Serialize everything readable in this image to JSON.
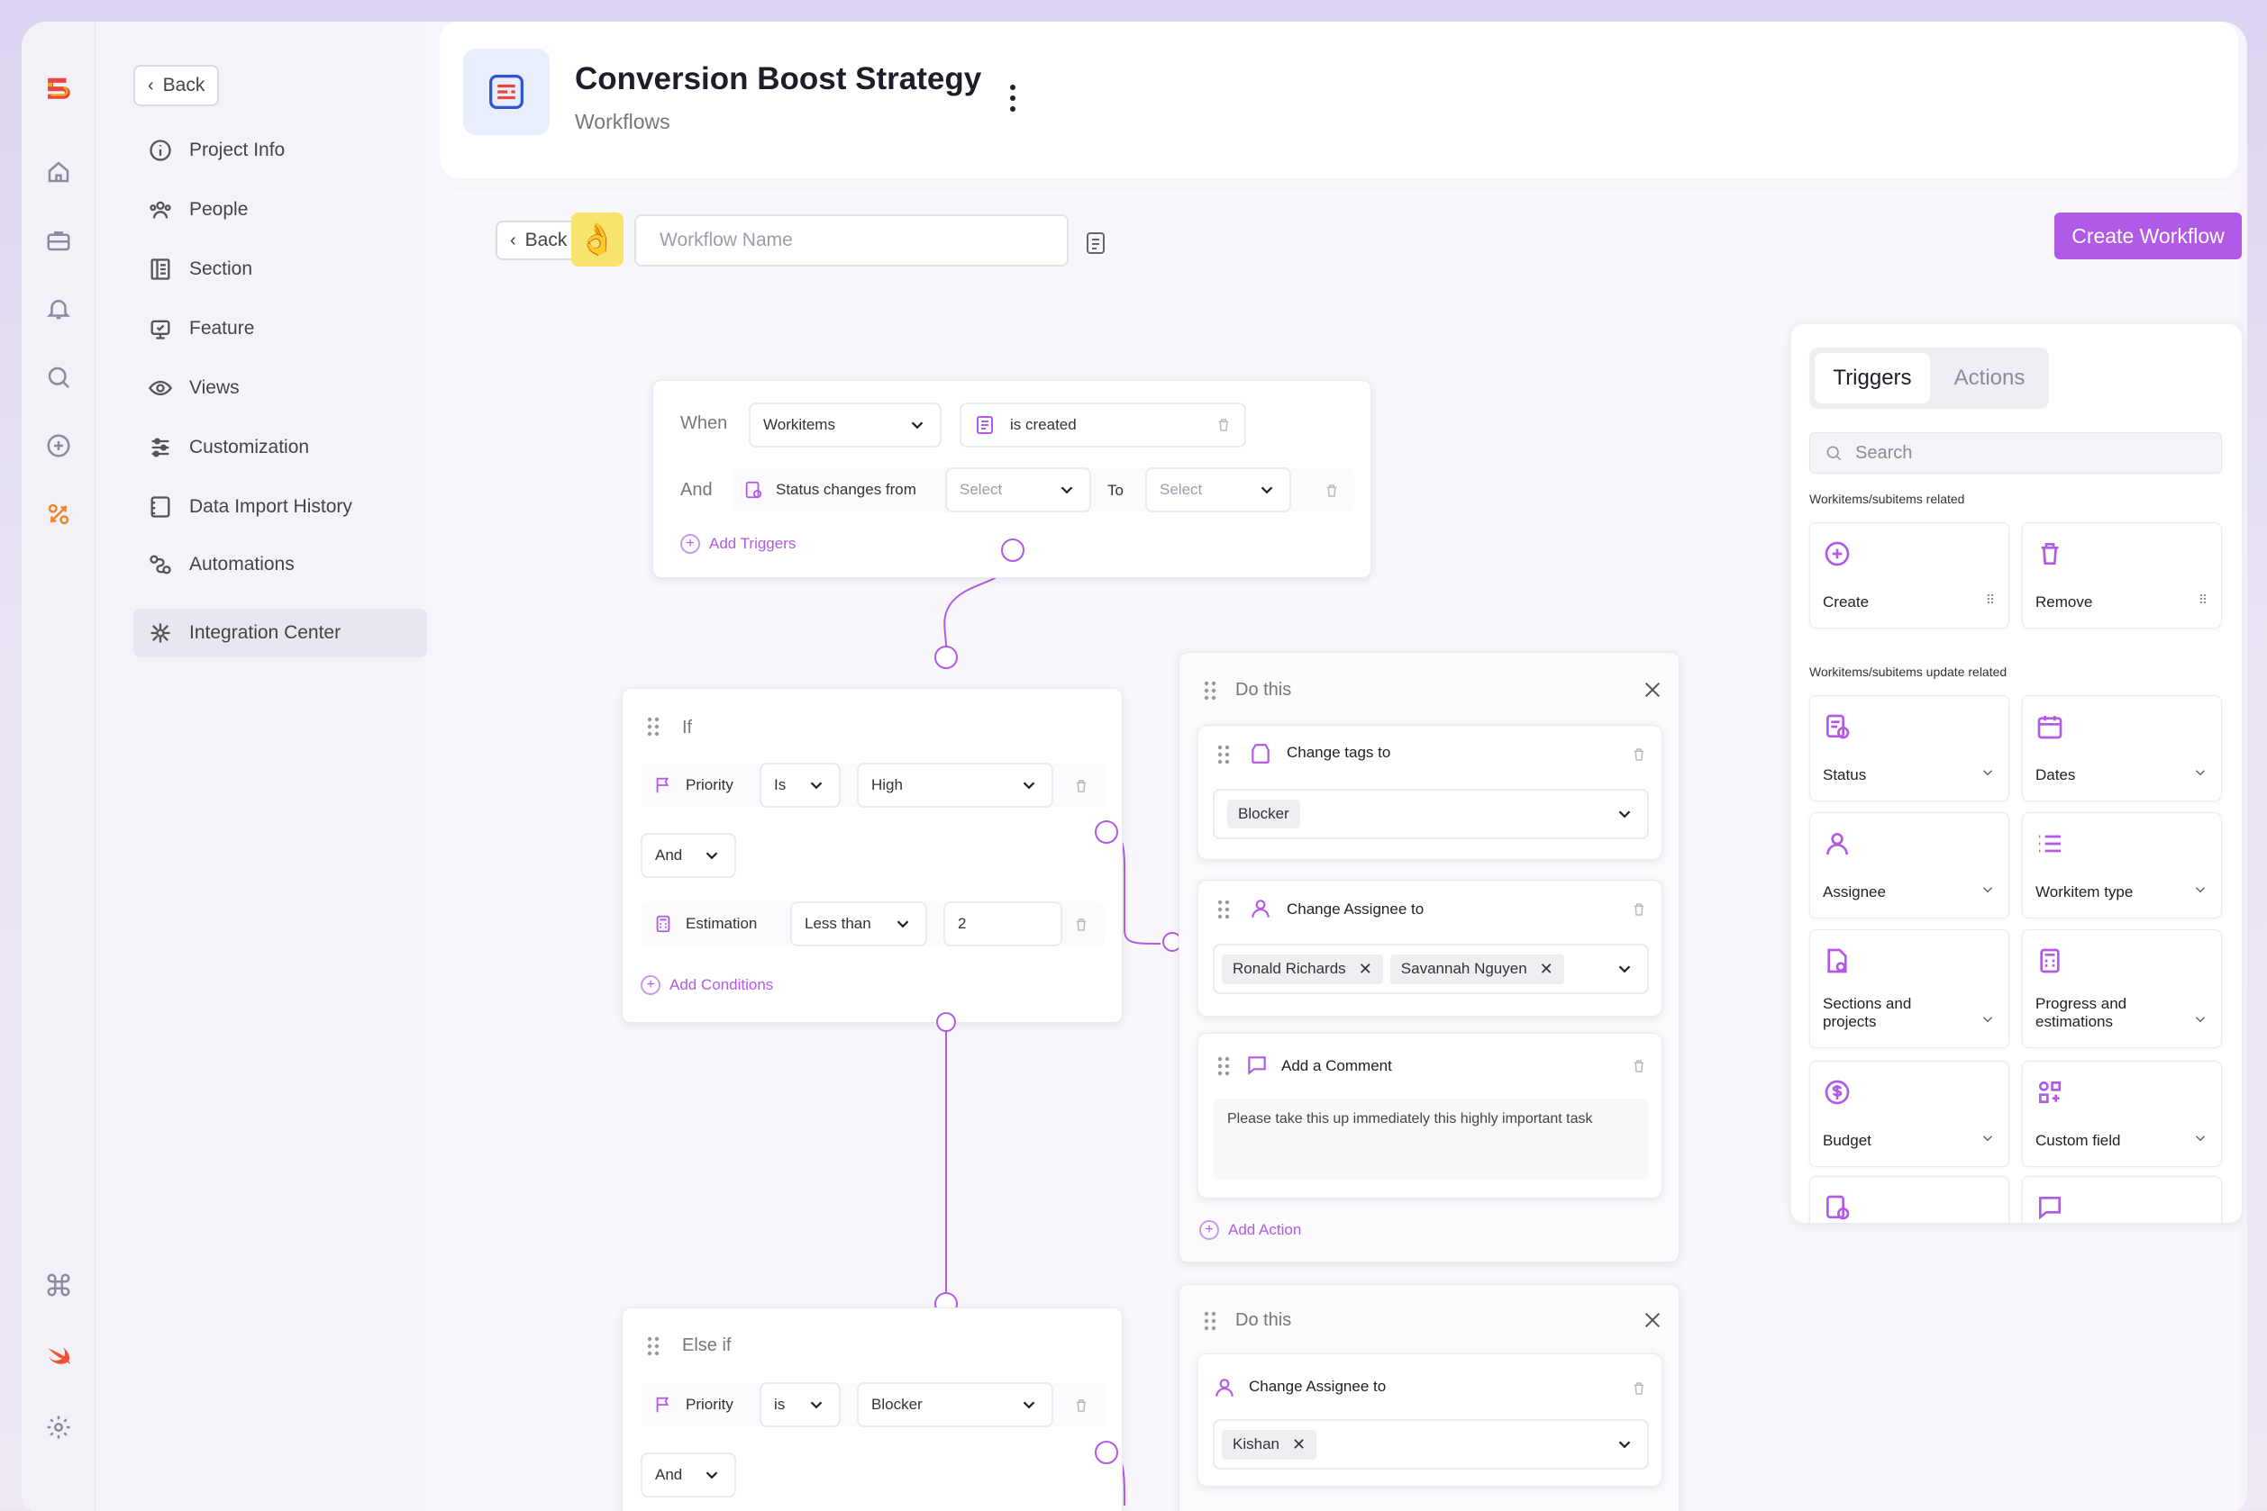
{
  "header": {
    "title": "Conversion Boost Strategy",
    "subtitle": "Workflows"
  },
  "nav": {
    "back_label": "Back",
    "items": [
      {
        "label": "Project Info",
        "icon": "info-icon"
      },
      {
        "label": "People",
        "icon": "people-icon"
      },
      {
        "label": "Section",
        "icon": "section-icon"
      },
      {
        "label": "Feature",
        "icon": "feature-icon"
      },
      {
        "label": "Views",
        "icon": "eye-icon"
      },
      {
        "label": "Customization",
        "icon": "sliders-icon"
      },
      {
        "label": "Data Import History",
        "icon": "import-icon"
      },
      {
        "label": "Automations",
        "icon": "automation-icon"
      },
      {
        "label": "Integration Center",
        "icon": "integration-icon"
      }
    ]
  },
  "toolbar": {
    "back_label": "Back",
    "emoji": "👌",
    "workflow_name_placeholder": "Workflow Name",
    "create_label": "Create Workflow"
  },
  "trigger": {
    "when_label": "When",
    "subject": "Workitems",
    "event": "is created",
    "and_label": "And",
    "condition": "Status changes from",
    "from_placeholder": "Select",
    "to_label": "To",
    "to_placeholder": "Select",
    "add_label": "Add Triggers"
  },
  "if_block": {
    "title": "If",
    "row1": {
      "field": "Priority",
      "op": "Is",
      "value": "High"
    },
    "join": "And",
    "row2": {
      "field": "Estimation",
      "op": "Less than",
      "value": "2"
    },
    "add_label": "Add Conditions"
  },
  "else_block": {
    "title": "Else if",
    "row1": {
      "field": "Priority",
      "op": "is",
      "value": "Blocker"
    },
    "join": "And"
  },
  "do1": {
    "title": "Do this",
    "action1": {
      "label": "Change tags to",
      "value": "Blocker"
    },
    "action2": {
      "label": "Change Assignee to",
      "chips": [
        "Ronald Richards",
        "Savannah Nguyen"
      ]
    },
    "action3": {
      "label": "Add a Comment",
      "text": "Please take this up immediately this highly important task"
    },
    "add_label": "Add Action"
  },
  "do2": {
    "title": "Do this",
    "action1": {
      "label": "Change Assignee to",
      "chips": [
        "Kishan"
      ]
    }
  },
  "panel": {
    "tab_triggers": "Triggers",
    "tab_actions": "Actions",
    "search_placeholder": "Search",
    "section1": "Workitems/subitems related",
    "section2": "Workitems/subitems update related",
    "tiles1": [
      "Create",
      "Remove"
    ],
    "tiles2": [
      "Status",
      "Dates",
      "Assignee",
      "Workitem type",
      "Sections and projects",
      "Progress and estimations",
      "Budget",
      "Custom field"
    ]
  },
  "colors": {
    "accent": "#b25ae8",
    "brand": "#e8473a"
  }
}
